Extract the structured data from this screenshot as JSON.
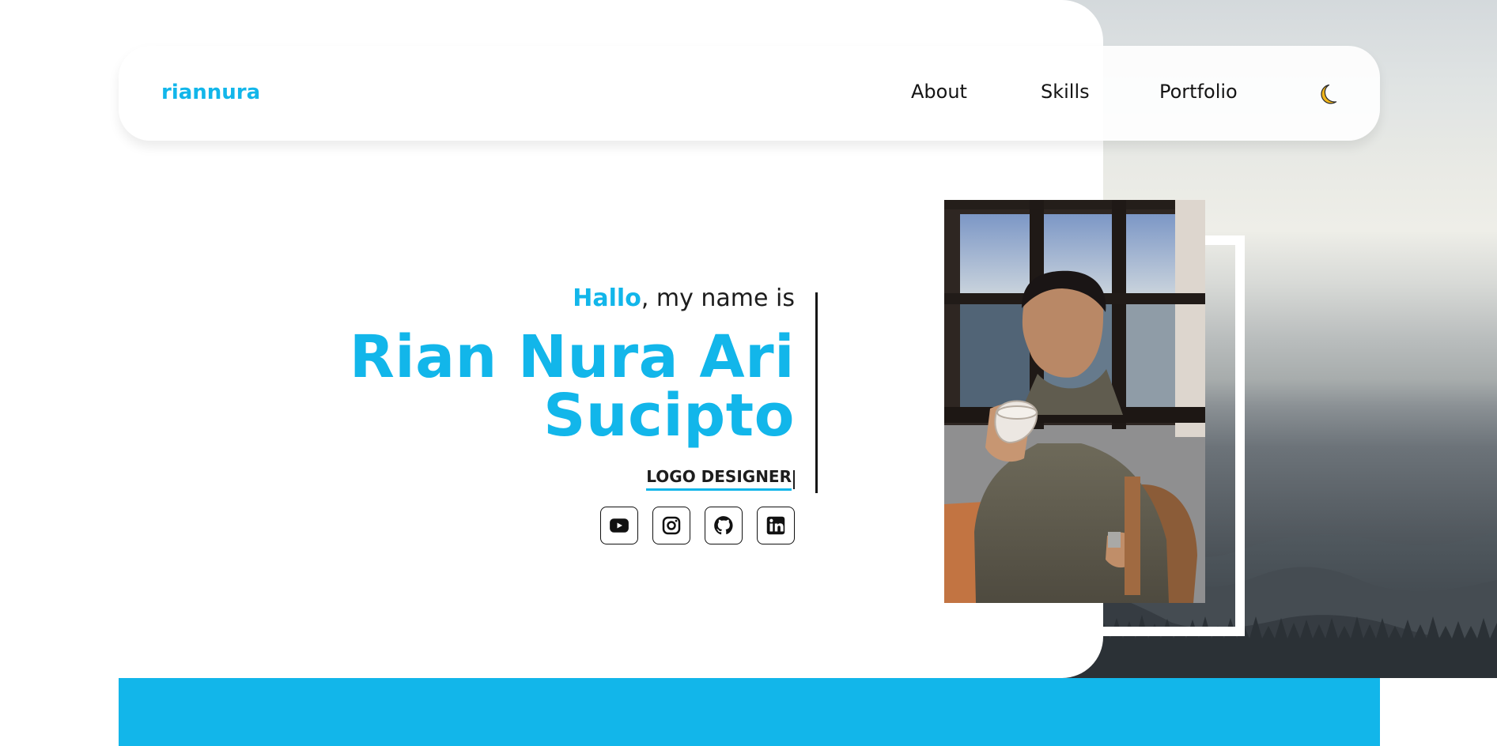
{
  "navbar": {
    "brand": "riannura",
    "links": [
      "About",
      "Skills",
      "Portfolio"
    ],
    "theme_toggle_icon": "moon-icon"
  },
  "hero": {
    "greeting_highlight": "Hallo",
    "greeting_rest": ", my name is",
    "name": "Rian Nura Ari Sucipto",
    "role": "LOGO DESIGNER"
  },
  "socials": [
    {
      "icon": "youtube-icon"
    },
    {
      "icon": "instagram-icon"
    },
    {
      "icon": "github-icon"
    },
    {
      "icon": "linkedin-icon"
    }
  ],
  "colors": {
    "accent": "#12b6ea",
    "text": "#1d1d1d",
    "background": "#ffffff"
  }
}
